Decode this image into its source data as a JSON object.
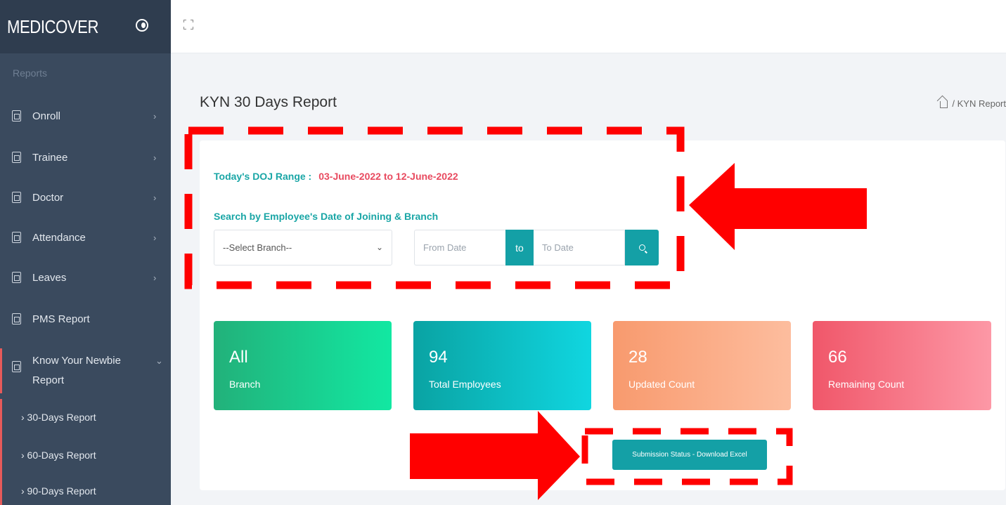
{
  "brand": "MEDICOVER",
  "sidebar": {
    "section": "Reports",
    "items": [
      {
        "label": "Onroll",
        "chevron": "›"
      },
      {
        "label": "Trainee",
        "chevron": "›"
      },
      {
        "label": "Doctor",
        "chevron": "›"
      },
      {
        "label": "Attendance",
        "chevron": "›"
      },
      {
        "label": "Leaves",
        "chevron": "›"
      },
      {
        "label": "PMS Report",
        "chevron": ""
      },
      {
        "label": "Know Your Newbie Report",
        "chevron": "⌄"
      }
    ],
    "subitems": [
      "› 30-Days Report",
      "› 60-Days Report",
      "› 90-Days Report"
    ]
  },
  "page": {
    "title": "KYN 30 Days Report",
    "breadcrumb": "/ KYN Report"
  },
  "filters": {
    "doj_range_label": "Today's DOJ Range :",
    "doj_range_value": "03-June-2022 to 12-June-2022",
    "search_label": "Search by Employee's Date of Joining & Branch",
    "branch_placeholder": "--Select Branch--",
    "from_date": "From Date",
    "to_label": "to",
    "to_date": "To Date"
  },
  "stats": [
    {
      "value": "All",
      "label": "Branch"
    },
    {
      "value": "94",
      "label": "Total Employees"
    },
    {
      "value": "28",
      "label": "Updated Count"
    },
    {
      "value": "66",
      "label": "Remaining Count"
    }
  ],
  "download_button": "Submission Status - Download Excel",
  "colors": {
    "sidebar": "#3a4a5e",
    "accent": "#14a0a6",
    "highlight": "#e84a5f",
    "annotation": "#ff0000"
  }
}
